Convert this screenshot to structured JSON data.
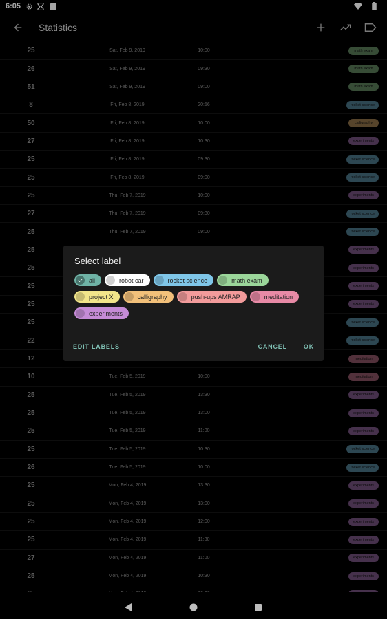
{
  "status_bar": {
    "time": "6:05"
  },
  "app_bar": {
    "title": "Statistics"
  },
  "label_colors": {
    "math exam": "#9bd69a",
    "rocket science": "#7fc6e8",
    "calligraphy": "#f2c07a",
    "experiments": "#c58bd6",
    "meditation": "#e88aa6",
    "robot car": "#ffffff",
    "project X": "#f2e58a",
    "push-ups AMRAP": "#f29b9b",
    "all": "#6fb3a6"
  },
  "rows": [
    {
      "duration": "25",
      "date": "Sat, Feb 9, 2019",
      "time": "10:00",
      "label": "math exam"
    },
    {
      "duration": "26",
      "date": "Sat, Feb 9, 2019",
      "time": "09:30",
      "label": "math exam"
    },
    {
      "duration": "51",
      "date": "Sat, Feb 9, 2019",
      "time": "09:00",
      "label": "math exam"
    },
    {
      "duration": "8",
      "date": "Fri, Feb 8, 2019",
      "time": "20:56",
      "label": "rocket science"
    },
    {
      "duration": "50",
      "date": "Fri, Feb 8, 2019",
      "time": "10:00",
      "label": "calligraphy"
    },
    {
      "duration": "27",
      "date": "Fri, Feb 8, 2019",
      "time": "10:30",
      "label": "experiments"
    },
    {
      "duration": "25",
      "date": "Fri, Feb 8, 2019",
      "time": "09:30",
      "label": "rocket science"
    },
    {
      "duration": "25",
      "date": "Fri, Feb 8, 2019",
      "time": "09:00",
      "label": "rocket science"
    },
    {
      "duration": "25",
      "date": "Thu, Feb 7, 2019",
      "time": "10:00",
      "label": "experiments"
    },
    {
      "duration": "27",
      "date": "Thu, Feb 7, 2019",
      "time": "09:30",
      "label": "rocket science"
    },
    {
      "duration": "25",
      "date": "Thu, Feb 7, 2019",
      "time": "09:00",
      "label": "rocket science"
    },
    {
      "duration": "25",
      "date": "",
      "time": "",
      "label": "experiments"
    },
    {
      "duration": "25",
      "date": "",
      "time": "",
      "label": "experiments"
    },
    {
      "duration": "25",
      "date": "",
      "time": "",
      "label": "experiments"
    },
    {
      "duration": "25",
      "date": "",
      "time": "",
      "label": "experiments"
    },
    {
      "duration": "25",
      "date": "",
      "time": "",
      "label": "rocket science"
    },
    {
      "duration": "22",
      "date": "",
      "time": "",
      "label": "rocket science"
    },
    {
      "duration": "12",
      "date": "",
      "time": "",
      "label": "meditation"
    },
    {
      "duration": "10",
      "date": "Tue, Feb 5, 2019",
      "time": "10:00",
      "label": "meditation"
    },
    {
      "duration": "25",
      "date": "Tue, Feb 5, 2019",
      "time": "13:30",
      "label": "experiments"
    },
    {
      "duration": "25",
      "date": "Tue, Feb 5, 2019",
      "time": "13:00",
      "label": "experiments"
    },
    {
      "duration": "25",
      "date": "Tue, Feb 5, 2019",
      "time": "11:00",
      "label": "experiments"
    },
    {
      "duration": "25",
      "date": "Tue, Feb 5, 2019",
      "time": "10:30",
      "label": "rocket science"
    },
    {
      "duration": "26",
      "date": "Tue, Feb 5, 2019",
      "time": "10:00",
      "label": "rocket science"
    },
    {
      "duration": "25",
      "date": "Mon, Feb 4, 2019",
      "time": "13:30",
      "label": "experiments"
    },
    {
      "duration": "25",
      "date": "Mon, Feb 4, 2019",
      "time": "13:00",
      "label": "experiments"
    },
    {
      "duration": "25",
      "date": "Mon, Feb 4, 2019",
      "time": "12:00",
      "label": "experiments"
    },
    {
      "duration": "25",
      "date": "Mon, Feb 4, 2019",
      "time": "11:30",
      "label": "experiments"
    },
    {
      "duration": "27",
      "date": "Mon, Feb 4, 2019",
      "time": "11:00",
      "label": "experiments"
    },
    {
      "duration": "25",
      "date": "Mon, Feb 4, 2019",
      "time": "10:30",
      "label": "experiments"
    },
    {
      "duration": "25",
      "date": "Mon, Feb 4, 2019",
      "time": "10:00",
      "label": "experiments"
    }
  ],
  "dialog": {
    "title": "Select label",
    "labels": [
      {
        "name": "all",
        "color": "#6fb3a6",
        "selected": true
      },
      {
        "name": "robot car",
        "color": "#ffffff",
        "selected": false
      },
      {
        "name": "rocket science",
        "color": "#7fc6e8",
        "selected": false
      },
      {
        "name": "math exam",
        "color": "#9bd69a",
        "selected": false
      },
      {
        "name": "project X",
        "color": "#f2e58a",
        "selected": false
      },
      {
        "name": "calligraphy",
        "color": "#f2c07a",
        "selected": false
      },
      {
        "name": "push-ups AMRAP",
        "color": "#f29b9b",
        "selected": false
      },
      {
        "name": "meditation",
        "color": "#e88aa6",
        "selected": false
      },
      {
        "name": "experiments",
        "color": "#c58bd6",
        "selected": false
      }
    ],
    "edit_labels": "EDIT LABELS",
    "cancel": "CANCEL",
    "ok": "OK"
  }
}
